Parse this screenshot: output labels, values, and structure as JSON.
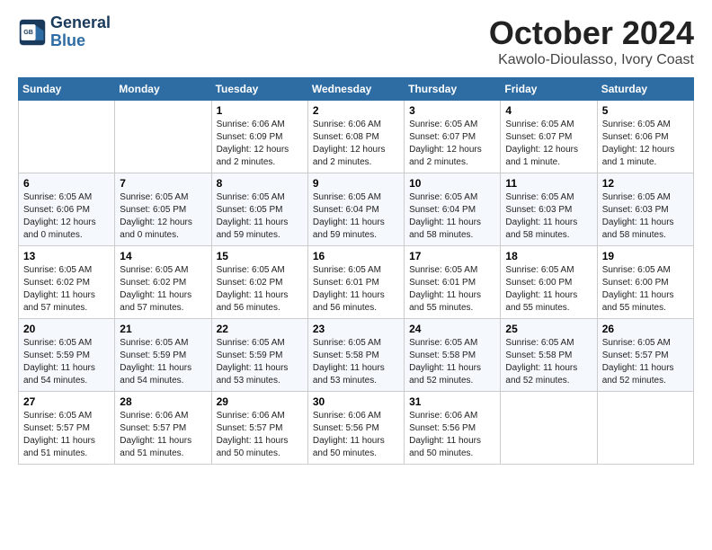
{
  "logo": {
    "line1": "General",
    "line2": "Blue"
  },
  "title": "October 2024",
  "location": "Kawolo-Dioulasso, Ivory Coast",
  "days_of_week": [
    "Sunday",
    "Monday",
    "Tuesday",
    "Wednesday",
    "Thursday",
    "Friday",
    "Saturday"
  ],
  "weeks": [
    [
      {
        "day": "",
        "info": ""
      },
      {
        "day": "",
        "info": ""
      },
      {
        "day": "1",
        "info": "Sunrise: 6:06 AM\nSunset: 6:09 PM\nDaylight: 12 hours\nand 2 minutes."
      },
      {
        "day": "2",
        "info": "Sunrise: 6:06 AM\nSunset: 6:08 PM\nDaylight: 12 hours\nand 2 minutes."
      },
      {
        "day": "3",
        "info": "Sunrise: 6:05 AM\nSunset: 6:07 PM\nDaylight: 12 hours\nand 2 minutes."
      },
      {
        "day": "4",
        "info": "Sunrise: 6:05 AM\nSunset: 6:07 PM\nDaylight: 12 hours\nand 1 minute."
      },
      {
        "day": "5",
        "info": "Sunrise: 6:05 AM\nSunset: 6:06 PM\nDaylight: 12 hours\nand 1 minute."
      }
    ],
    [
      {
        "day": "6",
        "info": "Sunrise: 6:05 AM\nSunset: 6:06 PM\nDaylight: 12 hours\nand 0 minutes."
      },
      {
        "day": "7",
        "info": "Sunrise: 6:05 AM\nSunset: 6:05 PM\nDaylight: 12 hours\nand 0 minutes."
      },
      {
        "day": "8",
        "info": "Sunrise: 6:05 AM\nSunset: 6:05 PM\nDaylight: 11 hours\nand 59 minutes."
      },
      {
        "day": "9",
        "info": "Sunrise: 6:05 AM\nSunset: 6:04 PM\nDaylight: 11 hours\nand 59 minutes."
      },
      {
        "day": "10",
        "info": "Sunrise: 6:05 AM\nSunset: 6:04 PM\nDaylight: 11 hours\nand 58 minutes."
      },
      {
        "day": "11",
        "info": "Sunrise: 6:05 AM\nSunset: 6:03 PM\nDaylight: 11 hours\nand 58 minutes."
      },
      {
        "day": "12",
        "info": "Sunrise: 6:05 AM\nSunset: 6:03 PM\nDaylight: 11 hours\nand 58 minutes."
      }
    ],
    [
      {
        "day": "13",
        "info": "Sunrise: 6:05 AM\nSunset: 6:02 PM\nDaylight: 11 hours\nand 57 minutes."
      },
      {
        "day": "14",
        "info": "Sunrise: 6:05 AM\nSunset: 6:02 PM\nDaylight: 11 hours\nand 57 minutes."
      },
      {
        "day": "15",
        "info": "Sunrise: 6:05 AM\nSunset: 6:02 PM\nDaylight: 11 hours\nand 56 minutes."
      },
      {
        "day": "16",
        "info": "Sunrise: 6:05 AM\nSunset: 6:01 PM\nDaylight: 11 hours\nand 56 minutes."
      },
      {
        "day": "17",
        "info": "Sunrise: 6:05 AM\nSunset: 6:01 PM\nDaylight: 11 hours\nand 55 minutes."
      },
      {
        "day": "18",
        "info": "Sunrise: 6:05 AM\nSunset: 6:00 PM\nDaylight: 11 hours\nand 55 minutes."
      },
      {
        "day": "19",
        "info": "Sunrise: 6:05 AM\nSunset: 6:00 PM\nDaylight: 11 hours\nand 55 minutes."
      }
    ],
    [
      {
        "day": "20",
        "info": "Sunrise: 6:05 AM\nSunset: 5:59 PM\nDaylight: 11 hours\nand 54 minutes."
      },
      {
        "day": "21",
        "info": "Sunrise: 6:05 AM\nSunset: 5:59 PM\nDaylight: 11 hours\nand 54 minutes."
      },
      {
        "day": "22",
        "info": "Sunrise: 6:05 AM\nSunset: 5:59 PM\nDaylight: 11 hours\nand 53 minutes."
      },
      {
        "day": "23",
        "info": "Sunrise: 6:05 AM\nSunset: 5:58 PM\nDaylight: 11 hours\nand 53 minutes."
      },
      {
        "day": "24",
        "info": "Sunrise: 6:05 AM\nSunset: 5:58 PM\nDaylight: 11 hours\nand 52 minutes."
      },
      {
        "day": "25",
        "info": "Sunrise: 6:05 AM\nSunset: 5:58 PM\nDaylight: 11 hours\nand 52 minutes."
      },
      {
        "day": "26",
        "info": "Sunrise: 6:05 AM\nSunset: 5:57 PM\nDaylight: 11 hours\nand 52 minutes."
      }
    ],
    [
      {
        "day": "27",
        "info": "Sunrise: 6:05 AM\nSunset: 5:57 PM\nDaylight: 11 hours\nand 51 minutes."
      },
      {
        "day": "28",
        "info": "Sunrise: 6:06 AM\nSunset: 5:57 PM\nDaylight: 11 hours\nand 51 minutes."
      },
      {
        "day": "29",
        "info": "Sunrise: 6:06 AM\nSunset: 5:57 PM\nDaylight: 11 hours\nand 50 minutes."
      },
      {
        "day": "30",
        "info": "Sunrise: 6:06 AM\nSunset: 5:56 PM\nDaylight: 11 hours\nand 50 minutes."
      },
      {
        "day": "31",
        "info": "Sunrise: 6:06 AM\nSunset: 5:56 PM\nDaylight: 11 hours\nand 50 minutes."
      },
      {
        "day": "",
        "info": ""
      },
      {
        "day": "",
        "info": ""
      }
    ]
  ]
}
